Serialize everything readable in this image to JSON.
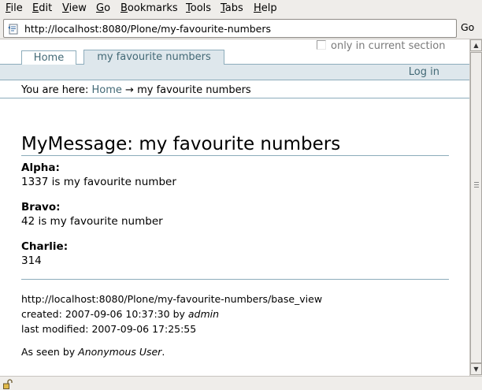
{
  "menubar": {
    "items": [
      {
        "first": "F",
        "rest": "ile"
      },
      {
        "first": "E",
        "rest": "dit"
      },
      {
        "first": "V",
        "rest": "iew"
      },
      {
        "first": "G",
        "rest": "o"
      },
      {
        "first": "B",
        "rest": "ookmarks"
      },
      {
        "first": "T",
        "rest": "ools"
      },
      {
        "first": "T",
        "rest": "abs"
      },
      {
        "first": "H",
        "rest": "elp"
      }
    ]
  },
  "locationbar": {
    "url": "http://localhost:8080/Plone/my-favourite-numbers",
    "go_label": "Go"
  },
  "portal": {
    "search_option": "only in current section",
    "tabs": [
      {
        "label": "Home",
        "selected": false
      },
      {
        "label": "my favourite numbers",
        "selected": true
      }
    ],
    "login_label": "Log in",
    "breadcrumbs": {
      "prefix": "You are here:",
      "home": "Home",
      "separator": "→",
      "current": "my favourite numbers"
    }
  },
  "document": {
    "title": "MyMessage: my favourite numbers",
    "fields": [
      {
        "label": "Alpha:",
        "value": "1337 is my favourite number"
      },
      {
        "label": "Bravo:",
        "value": "42 is my favourite number"
      },
      {
        "label": "Charlie:",
        "value": "314"
      }
    ],
    "meta": {
      "view_url": "http://localhost:8080/Plone/my-favourite-numbers/base_view",
      "created_prefix": "created:",
      "created_date": "2007-09-06 10:37:30",
      "by": "by",
      "creator": "admin",
      "modified_prefix": "last modified:",
      "modified_date": "2007-09-06 17:25:55",
      "seen_prefix": "As seen by",
      "seen_user": "Anonymous User",
      "seen_suffix": "."
    }
  },
  "colors": {
    "link": "#436976",
    "portal_border": "#8cacbb",
    "portal_bar_bg": "#dee7ec",
    "chrome_bg": "#efedea"
  },
  "icons": {
    "url_icon": "page-icon",
    "status_icon": "unlocked-padlock-icon"
  }
}
